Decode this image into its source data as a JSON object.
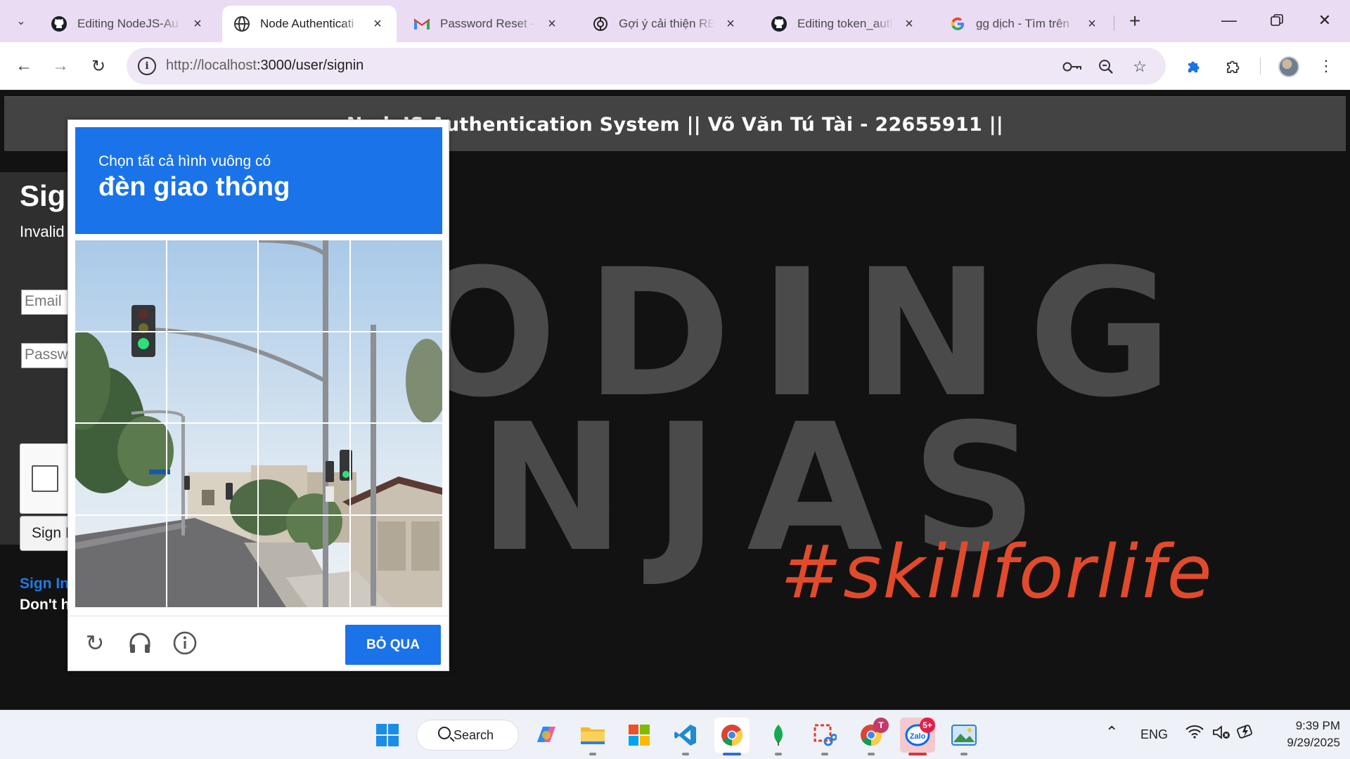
{
  "tabs": [
    {
      "title": "Editing NodeJS-Au",
      "favicon": "github-icon"
    },
    {
      "title": "Node Authenticati",
      "favicon": "globe-icon",
      "active": true
    },
    {
      "title": "Password Reset - t",
      "favicon": "gmail-icon"
    },
    {
      "title": "Gợi ý cải thiện REA",
      "favicon": "chatgpt-icon"
    },
    {
      "title": "Editing token_auth",
      "favicon": "github-icon"
    },
    {
      "title": "gg dịch - Tìm trên",
      "favicon": "google-icon"
    }
  ],
  "omnibox": {
    "url_host": "http://localhost",
    "url_rest": ":3000/user/signin"
  },
  "page": {
    "header_title": "NodeJS Authentication System || Võ Văn Tú Tài - 22655911 ||",
    "bg_word_1": "ODING",
    "bg_word_2": "NJAS",
    "bg_tagline": "#skillforlife",
    "signin": {
      "title": "Sign In",
      "message": "Invalid",
      "email_placeholder": "Email",
      "password_placeholder": "Password",
      "button_label": "Sign In",
      "link_label": "Sign In",
      "note": "Don't have an account?"
    }
  },
  "captcha": {
    "instruction": "Chọn tất cả hình vuông có",
    "target": "đèn giao thông",
    "skip_label": "BỎ QUA",
    "accent": "#1a73e8"
  },
  "taskbar": {
    "search_label": "Search",
    "zalo_badge": "5+",
    "chrome_badge": "T",
    "lang": "ENG",
    "time": "9:39 PM",
    "date": "9/29/2025"
  }
}
